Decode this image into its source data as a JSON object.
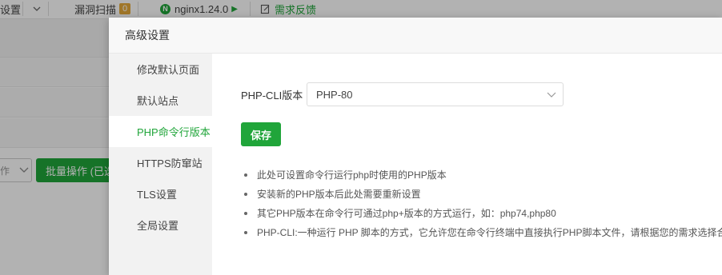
{
  "topbar": {
    "settings_fragment": "设置",
    "vuln_scan_label": "漏洞扫描",
    "vuln_scan_count": "0",
    "nginx_label": "nginx1.24.0",
    "feedback_label": "需求反馈"
  },
  "background": {
    "select_fragment": "作",
    "batch_button_label": "批量操作 (已选"
  },
  "modal": {
    "title": "高级设置",
    "sidebar": [
      {
        "label": "修改默认页面"
      },
      {
        "label": "默认站点"
      },
      {
        "label": "PHP命令行版本",
        "active": true
      },
      {
        "label": "HTTPS防窜站"
      },
      {
        "label": "TLS设置"
      },
      {
        "label": "全局设置"
      }
    ],
    "php_cli": {
      "label": "PHP-CLI版本",
      "value": "PHP-80"
    },
    "save_label": "保存",
    "notes": [
      "此处可设置命令行运行php时使用的PHP版本",
      "安装新的PHP版本后此处需要重新设置",
      "其它PHP版本在命令行可通过php+版本的方式运行，如：php74,php80",
      "PHP-CLI:一种运行 PHP 脚本的方式，它允许您在命令行终端中直接执行PHP脚本文件，请根据您的需求选择合"
    ]
  },
  "colors": {
    "accent": "#20a53a",
    "badge": "#e5a93a"
  }
}
